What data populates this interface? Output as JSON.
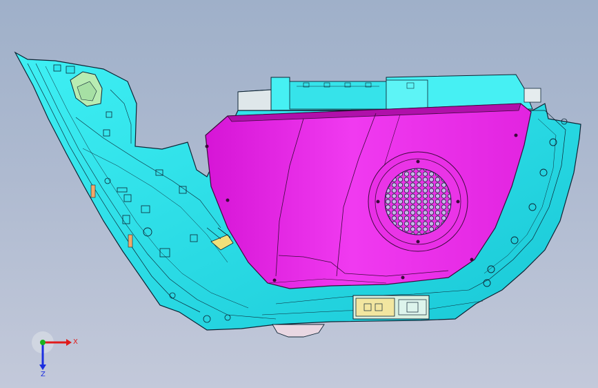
{
  "viewport": {
    "background_top": "#9fb0c9",
    "background_bottom": "#c3c9da"
  },
  "part_colors": {
    "trim_panel": "#2ee6ee",
    "trim_panel_dark": "#17c6d4",
    "speaker_cover": "#ee1fe6",
    "speaker_cover_dark": "#c411c0",
    "top_bracket": "#44f0f2",
    "latch_module": "#f3e8a4",
    "edge_lines": "#0c2333"
  },
  "axis_triad": {
    "x_label": "X",
    "z_label": "Z",
    "x_color": "#e01b1b",
    "y_color": "#1bb31b",
    "z_color": "#1b2ee0"
  }
}
